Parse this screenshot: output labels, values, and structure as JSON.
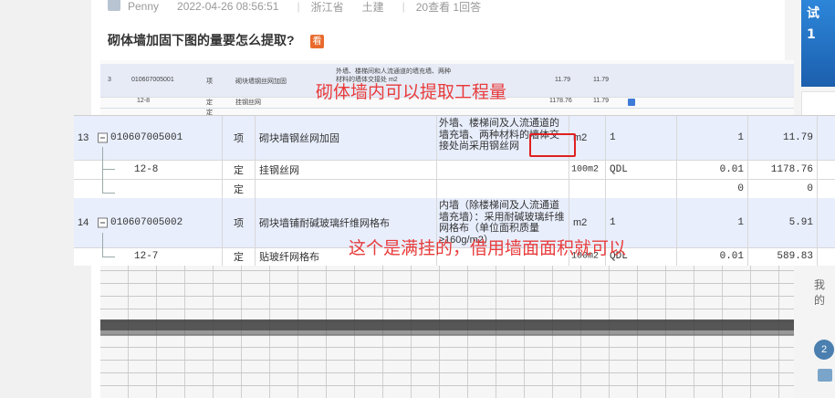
{
  "post": {
    "author": "Penny",
    "datetime": "2022-04-26 08:56:51",
    "region": "浙江省",
    "category": "土建",
    "stats": "20查看 1回答",
    "title": "砌体墙加固下图的量要怎么提取?",
    "badge": "看"
  },
  "sidebar": {
    "banner_text_1": "试",
    "banner_text_2": "1",
    "side_text": "我的",
    "badge_text": "2"
  },
  "annotations": {
    "top": "砌体墙内可以提取工程量",
    "middle": "这个是满挂的，借用墙面面积就可以"
  },
  "background_table": {
    "rows": [
      {
        "num": "3",
        "code": "010607005001",
        "type": "项",
        "name": "砌块墙钢丝网加固",
        "desc": "外墙、楼梯间和人流通道的墙充墙、两种材料的墙体交接处 m2",
        "qty": "11.79",
        "total": "11.79"
      },
      {
        "num": "",
        "code": "12-8",
        "type": "定",
        "name": "挂钢丝网",
        "desc": "",
        "qty": "1178.76",
        "total": "11.79"
      },
      {
        "num": "",
        "code": "",
        "type": "定",
        "name": "",
        "desc": "",
        "qty": "",
        "total": ""
      }
    ]
  },
  "zoom_table": {
    "rows": [
      {
        "num": "13",
        "code": "010607005001",
        "type": "项",
        "name": "砌块墙钢丝网加固",
        "desc": "外墙、楼梯间及人流通道的墙充墙、两种材料的墙体交接处尚采用钢丝网",
        "unit": "m2",
        "expr": "1",
        "ratio": "1",
        "qty": "11.79"
      },
      {
        "num": "",
        "code": "12-8",
        "type": "定",
        "name": "挂钢丝网",
        "desc": "",
        "unit": "100m2",
        "expr": "QDL",
        "ratio": "0.01",
        "qty": "1178.76"
      },
      {
        "num": "",
        "code": "",
        "type": "定",
        "name": "",
        "desc": "",
        "unit": "",
        "expr": "",
        "ratio": "0",
        "qty": "0"
      },
      {
        "num": "14",
        "code": "010607005002",
        "type": "项",
        "name": "砌块墙铺耐碱玻璃纤维网格布",
        "desc": "内墙（除楼梯间及人流通道墙充墙）：采用耐碱玻璃纤维网格布（单位面积质量≥160g/m2）",
        "unit": "m2",
        "expr": "1",
        "ratio": "1",
        "qty": "5.91"
      },
      {
        "num": "",
        "code": "12-7",
        "type": "定",
        "name": "贴玻纤网格布",
        "desc": "",
        "unit": "100m2",
        "expr": "QDL",
        "ratio": "0.01",
        "qty": "589.83"
      }
    ]
  },
  "colors": {
    "highlight_row": "#e8eefc",
    "annotation_red": "#e83c3c",
    "badge_orange": "#e86b2e",
    "banner_blue": "#2d86d9"
  }
}
